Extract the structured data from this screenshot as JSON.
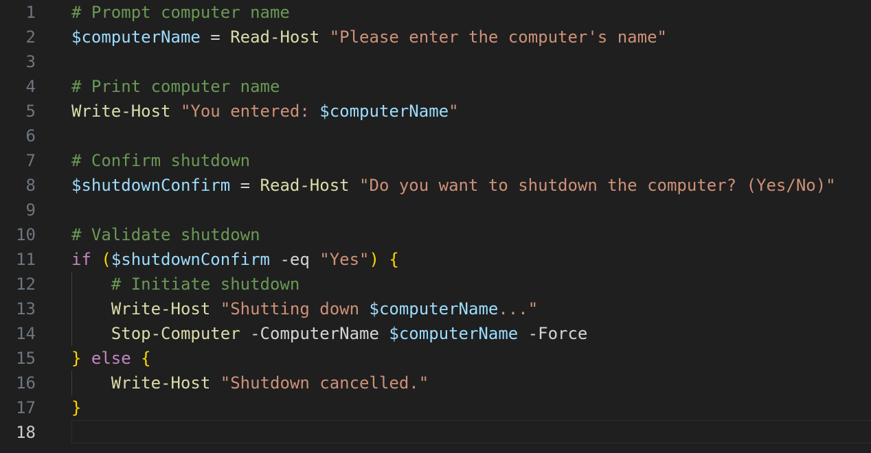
{
  "editor": {
    "colors": {
      "background": "#1f1f1f",
      "comment": "#6a9955",
      "variable": "#9cdcfe",
      "function": "#dcdcaa",
      "string": "#ce9178",
      "plain": "#d4d4d4",
      "keyword": "#c586c0",
      "bracket": "#ffd700",
      "line_number": "#6e7681",
      "line_number_active": "#cccccc"
    },
    "active_line": 18,
    "lines": [
      {
        "n": "1",
        "tokens": [
          {
            "t": "# Prompt computer name",
            "c": "comment"
          }
        ]
      },
      {
        "n": "2",
        "tokens": [
          {
            "t": "$computerName",
            "c": "variable"
          },
          {
            "t": " = ",
            "c": "plain"
          },
          {
            "t": "Read-Host",
            "c": "function"
          },
          {
            "t": " ",
            "c": "plain"
          },
          {
            "t": "\"Please enter the computer's name\"",
            "c": "string"
          }
        ]
      },
      {
        "n": "3",
        "tokens": []
      },
      {
        "n": "4",
        "tokens": [
          {
            "t": "# Print computer name",
            "c": "comment"
          }
        ]
      },
      {
        "n": "5",
        "tokens": [
          {
            "t": "Write-Host",
            "c": "function"
          },
          {
            "t": " ",
            "c": "plain"
          },
          {
            "t": "\"You entered: ",
            "c": "string"
          },
          {
            "t": "$computerName",
            "c": "variable"
          },
          {
            "t": "\"",
            "c": "string"
          }
        ]
      },
      {
        "n": "6",
        "tokens": []
      },
      {
        "n": "7",
        "tokens": [
          {
            "t": "# Confirm shutdown",
            "c": "comment"
          }
        ]
      },
      {
        "n": "8",
        "tokens": [
          {
            "t": "$shutdownConfirm",
            "c": "variable"
          },
          {
            "t": " = ",
            "c": "plain"
          },
          {
            "t": "Read-Host",
            "c": "function"
          },
          {
            "t": " ",
            "c": "plain"
          },
          {
            "t": "\"Do you want to shutdown the computer? (Yes/No)\"",
            "c": "string"
          }
        ]
      },
      {
        "n": "9",
        "tokens": []
      },
      {
        "n": "10",
        "tokens": [
          {
            "t": "# Validate shutdown",
            "c": "comment"
          }
        ]
      },
      {
        "n": "11",
        "tokens": [
          {
            "t": "if",
            "c": "keyword"
          },
          {
            "t": " ",
            "c": "plain"
          },
          {
            "t": "(",
            "c": "bracket"
          },
          {
            "t": "$shutdownConfirm",
            "c": "variable"
          },
          {
            "t": " -eq ",
            "c": "plain"
          },
          {
            "t": "\"Yes\"",
            "c": "string"
          },
          {
            "t": ")",
            "c": "bracket"
          },
          {
            "t": " ",
            "c": "plain"
          },
          {
            "t": "{",
            "c": "bracket"
          }
        ]
      },
      {
        "n": "12",
        "tokens": [
          {
            "t": "    ",
            "c": "plain"
          },
          {
            "t": "# Initiate shutdown",
            "c": "comment"
          }
        ]
      },
      {
        "n": "13",
        "tokens": [
          {
            "t": "    ",
            "c": "plain"
          },
          {
            "t": "Write-Host",
            "c": "function"
          },
          {
            "t": " ",
            "c": "plain"
          },
          {
            "t": "\"Shutting down ",
            "c": "string"
          },
          {
            "t": "$computerName",
            "c": "variable"
          },
          {
            "t": "...\"",
            "c": "string"
          }
        ]
      },
      {
        "n": "14",
        "tokens": [
          {
            "t": "    ",
            "c": "plain"
          },
          {
            "t": "Stop-Computer",
            "c": "function"
          },
          {
            "t": " -ComputerName ",
            "c": "plain"
          },
          {
            "t": "$computerName",
            "c": "variable"
          },
          {
            "t": " -Force",
            "c": "plain"
          }
        ]
      },
      {
        "n": "15",
        "tokens": [
          {
            "t": "}",
            "c": "bracket"
          },
          {
            "t": " ",
            "c": "plain"
          },
          {
            "t": "else",
            "c": "keyword"
          },
          {
            "t": " ",
            "c": "plain"
          },
          {
            "t": "{",
            "c": "bracket"
          }
        ]
      },
      {
        "n": "16",
        "tokens": [
          {
            "t": "    ",
            "c": "plain"
          },
          {
            "t": "Write-Host",
            "c": "function"
          },
          {
            "t": " ",
            "c": "plain"
          },
          {
            "t": "\"Shutdown cancelled.\"",
            "c": "string"
          }
        ]
      },
      {
        "n": "17",
        "tokens": [
          {
            "t": "}",
            "c": "bracket"
          }
        ]
      },
      {
        "n": "18",
        "tokens": []
      }
    ]
  }
}
